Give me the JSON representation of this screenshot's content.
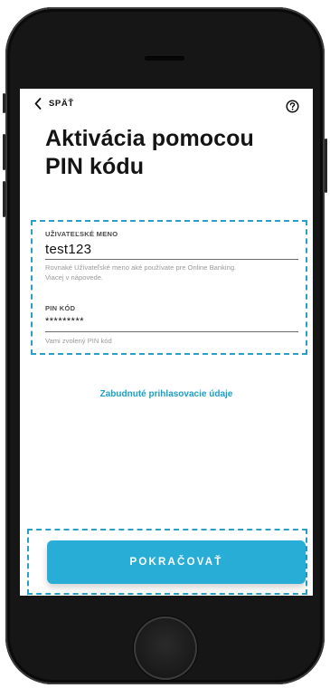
{
  "header": {
    "back_label": "SPÄŤ",
    "back_icon": "chevron-left-icon",
    "help_icon": "question-circle-icon"
  },
  "title": {
    "line1": "Aktivácia pomocou",
    "line2": "PIN kódu"
  },
  "form": {
    "username": {
      "label": "UŽIVATEĽSKÉ MENO",
      "value": "test123",
      "hint_line1": "Rovnaké Užívateľské meno aké používate pre Online Banking.",
      "hint_line2": "Viacej v nápovede."
    },
    "pin": {
      "label": "PIN KÓD",
      "value": "*********",
      "hint": "Vami zvolený PIN kód"
    }
  },
  "forgot_link": "Zabudnuté prihlasovacie údaje",
  "continue_button": "POKRAČOVAŤ",
  "colors": {
    "accent": "#28aed6",
    "link": "#1a9fc7",
    "highlight_dash": "#2b9fc6",
    "frame": "#161616"
  }
}
